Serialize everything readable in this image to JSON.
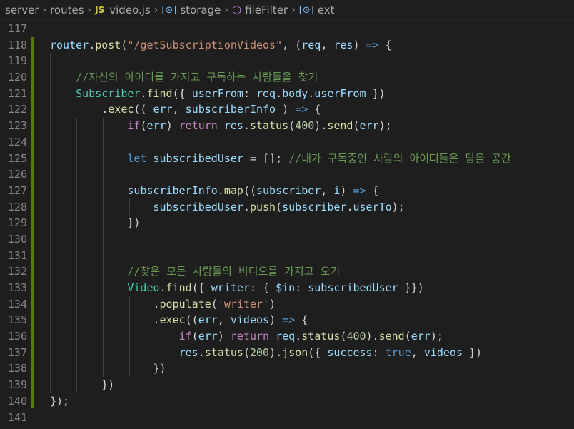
{
  "breadcrumb": {
    "items": [
      {
        "label": "server",
        "icon": ""
      },
      {
        "label": "routes",
        "icon": ""
      },
      {
        "label": "video.js",
        "icon": "js-file-icon"
      },
      {
        "label": "storage",
        "icon": "symbol-variable-icon"
      },
      {
        "label": "fileFilter",
        "icon": "symbol-method-icon"
      },
      {
        "label": "ext",
        "icon": "symbol-variable-icon"
      }
    ]
  },
  "editor": {
    "line_numbers": [
      "117",
      "118",
      "119",
      "120",
      "121",
      "122",
      "123",
      "124",
      "125",
      "126",
      "127",
      "128",
      "129",
      "130",
      "131",
      "132",
      "133",
      "134",
      "135",
      "136",
      "137",
      "138",
      "139",
      "140",
      "141"
    ],
    "lines": [
      [],
      [
        [
          "t-var",
          "router"
        ],
        [
          "t-pun",
          "."
        ],
        [
          "t-fn",
          "post"
        ],
        [
          "t-pun",
          "("
        ],
        [
          "t-str",
          "\"/getSubscriptionVideos\""
        ],
        [
          "t-pun",
          ", ("
        ],
        [
          "t-var",
          "req"
        ],
        [
          "t-pun",
          ", "
        ],
        [
          "t-var",
          "res"
        ],
        [
          "t-pun",
          ") "
        ],
        [
          "t-kw",
          "=>"
        ],
        [
          "t-pun",
          " {"
        ]
      ],
      [],
      [
        [
          "t-pun",
          "    "
        ],
        [
          "t-com",
          "//자신의 아이디를 가지고 구독하는 사람들을 찾기"
        ]
      ],
      [
        [
          "t-pun",
          "    "
        ],
        [
          "t-cls",
          "Subscriber"
        ],
        [
          "t-pun",
          "."
        ],
        [
          "t-fn",
          "find"
        ],
        [
          "t-pun",
          "({ "
        ],
        [
          "t-var",
          "userFrom"
        ],
        [
          "t-pun",
          ": "
        ],
        [
          "t-var",
          "req"
        ],
        [
          "t-pun",
          "."
        ],
        [
          "t-var",
          "body"
        ],
        [
          "t-pun",
          "."
        ],
        [
          "t-var",
          "userFrom"
        ],
        [
          "t-pun",
          " })"
        ]
      ],
      [
        [
          "t-pun",
          "        ."
        ],
        [
          "t-fn",
          "exec"
        ],
        [
          "t-pun",
          "(( "
        ],
        [
          "t-var",
          "err"
        ],
        [
          "t-pun",
          ", "
        ],
        [
          "t-var",
          "subscriberInfo"
        ],
        [
          "t-pun",
          " ) "
        ],
        [
          "t-kw",
          "=>"
        ],
        [
          "t-pun",
          " {"
        ]
      ],
      [
        [
          "t-pun",
          "            "
        ],
        [
          "t-ctl",
          "if"
        ],
        [
          "t-pun",
          "("
        ],
        [
          "t-var",
          "err"
        ],
        [
          "t-pun",
          ") "
        ],
        [
          "t-ctl",
          "return"
        ],
        [
          "t-pun",
          " "
        ],
        [
          "t-var",
          "res"
        ],
        [
          "t-pun",
          "."
        ],
        [
          "t-fn",
          "status"
        ],
        [
          "t-pun",
          "("
        ],
        [
          "t-num",
          "400"
        ],
        [
          "t-pun",
          ")."
        ],
        [
          "t-fn",
          "send"
        ],
        [
          "t-pun",
          "("
        ],
        [
          "t-var",
          "err"
        ],
        [
          "t-pun",
          ");"
        ]
      ],
      [],
      [
        [
          "t-pun",
          "            "
        ],
        [
          "t-kw",
          "let"
        ],
        [
          "t-pun",
          " "
        ],
        [
          "t-var",
          "subscribedUser"
        ],
        [
          "t-pun",
          " = []; "
        ],
        [
          "t-com",
          "//내가 구독중인 사람의 아이디들은 담을 공간"
        ]
      ],
      [],
      [
        [
          "t-pun",
          "            "
        ],
        [
          "t-var",
          "subscriberInfo"
        ],
        [
          "t-pun",
          "."
        ],
        [
          "t-fn",
          "map"
        ],
        [
          "t-pun",
          "(("
        ],
        [
          "t-var",
          "subscriber"
        ],
        [
          "t-pun",
          ", "
        ],
        [
          "t-var",
          "i"
        ],
        [
          "t-pun",
          ") "
        ],
        [
          "t-kw",
          "=>"
        ],
        [
          "t-pun",
          " {"
        ]
      ],
      [
        [
          "t-pun",
          "                "
        ],
        [
          "t-var",
          "subscribedUser"
        ],
        [
          "t-pun",
          "."
        ],
        [
          "t-fn",
          "push"
        ],
        [
          "t-pun",
          "("
        ],
        [
          "t-var",
          "subscriber"
        ],
        [
          "t-pun",
          "."
        ],
        [
          "t-var",
          "userTo"
        ],
        [
          "t-pun",
          ");"
        ]
      ],
      [
        [
          "t-pun",
          "            })"
        ]
      ],
      [],
      [],
      [
        [
          "t-pun",
          "            "
        ],
        [
          "t-com",
          "//찾은 모든 사람들의 비디오를 가지고 오기"
        ]
      ],
      [
        [
          "t-pun",
          "            "
        ],
        [
          "t-cls",
          "Video"
        ],
        [
          "t-pun",
          "."
        ],
        [
          "t-fn",
          "find"
        ],
        [
          "t-pun",
          "({ "
        ],
        [
          "t-var",
          "writer"
        ],
        [
          "t-pun",
          ": { "
        ],
        [
          "t-var",
          "$in"
        ],
        [
          "t-pun",
          ": "
        ],
        [
          "t-var",
          "subscribedUser"
        ],
        [
          "t-pun",
          " }})"
        ]
      ],
      [
        [
          "t-pun",
          "                ."
        ],
        [
          "t-fn",
          "populate"
        ],
        [
          "t-pun",
          "("
        ],
        [
          "t-str",
          "'writer'"
        ],
        [
          "t-pun",
          ")"
        ]
      ],
      [
        [
          "t-pun",
          "                ."
        ],
        [
          "t-fn",
          "exec"
        ],
        [
          "t-pun",
          "(("
        ],
        [
          "t-var",
          "err"
        ],
        [
          "t-pun",
          ", "
        ],
        [
          "t-var",
          "videos"
        ],
        [
          "t-pun",
          ") "
        ],
        [
          "t-kw",
          "=>"
        ],
        [
          "t-pun",
          " {"
        ]
      ],
      [
        [
          "t-pun",
          "                    "
        ],
        [
          "t-ctl",
          "if"
        ],
        [
          "t-pun",
          "("
        ],
        [
          "t-var",
          "err"
        ],
        [
          "t-pun",
          ") "
        ],
        [
          "t-ctl",
          "return"
        ],
        [
          "t-pun",
          " "
        ],
        [
          "t-var",
          "req"
        ],
        [
          "t-pun",
          "."
        ],
        [
          "t-fn",
          "status"
        ],
        [
          "t-pun",
          "("
        ],
        [
          "t-num",
          "400"
        ],
        [
          "t-pun",
          ")."
        ],
        [
          "t-fn",
          "send"
        ],
        [
          "t-pun",
          "("
        ],
        [
          "t-var",
          "err"
        ],
        [
          "t-pun",
          ");"
        ]
      ],
      [
        [
          "t-pun",
          "                    "
        ],
        [
          "t-var",
          "res"
        ],
        [
          "t-pun",
          "."
        ],
        [
          "t-fn",
          "status"
        ],
        [
          "t-pun",
          "("
        ],
        [
          "t-num",
          "200"
        ],
        [
          "t-pun",
          ")."
        ],
        [
          "t-fn",
          "json"
        ],
        [
          "t-pun",
          "({ "
        ],
        [
          "t-var",
          "success"
        ],
        [
          "t-pun",
          ": "
        ],
        [
          "t-kw",
          "true"
        ],
        [
          "t-pun",
          ", "
        ],
        [
          "t-var",
          "videos"
        ],
        [
          "t-pun",
          " })"
        ]
      ],
      [
        [
          "t-pun",
          "                })"
        ]
      ],
      [
        [
          "t-pun",
          "        })"
        ]
      ],
      [
        [
          "t-pun",
          "});"
        ]
      ],
      []
    ]
  }
}
